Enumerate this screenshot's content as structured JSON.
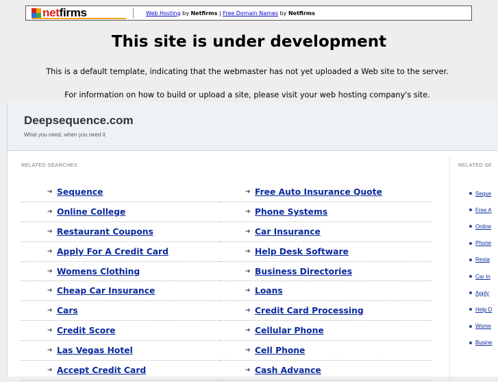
{
  "topbar": {
    "logo_text_n": "net",
    "logo_text_f": "firms",
    "link1": "Web Hosting",
    "by1": " by ",
    "brand1": "Netfirms",
    "sep": " | ",
    "link2": "Free Domain Names",
    "by2": " by ",
    "brand2": "Netfirms",
    "colors": {
      "accent_red": "#d8211c",
      "accent_orange": "#f6a01a"
    }
  },
  "headline": "This site is under development",
  "message1": "This is a default template, indicating that the webmaster has not yet uploaded a Web site to the server.",
  "message2": "For information on how to build or upload a site, please visit your web hosting company's site.",
  "parked": {
    "title": "Deepsequence.com",
    "tagline": "What you need, when you need it",
    "related_label": "RELATED SEARCHES",
    "related_label_right": "RELATED SE",
    "head_mark": "/",
    "left_column": [
      "Sequence",
      "Online College",
      "Restaurant Coupons",
      "Apply For A Credit Card",
      "Womens Clothing",
      "Cheap Car Insurance",
      "Cars",
      "Credit Score",
      "Las Vegas Hotel",
      "Accept Credit Card"
    ],
    "right_column": [
      "Free Auto Insurance Quote",
      "Phone Systems",
      "Car Insurance",
      "Help Desk Software",
      "Business Directories",
      "Loans",
      "Credit Card Processing",
      "Cellular Phone",
      "Cell Phone",
      "Cash Advance"
    ],
    "sidebar": [
      "Seque",
      "Free A",
      "Online",
      "Phone",
      "Resta",
      "Car In",
      "Apply",
      "Help D",
      "Wome",
      "Busine"
    ],
    "arrow_glyph": "➔",
    "colors": {
      "link": "#0b2a9c",
      "header_bg": "#edf3f5"
    }
  }
}
